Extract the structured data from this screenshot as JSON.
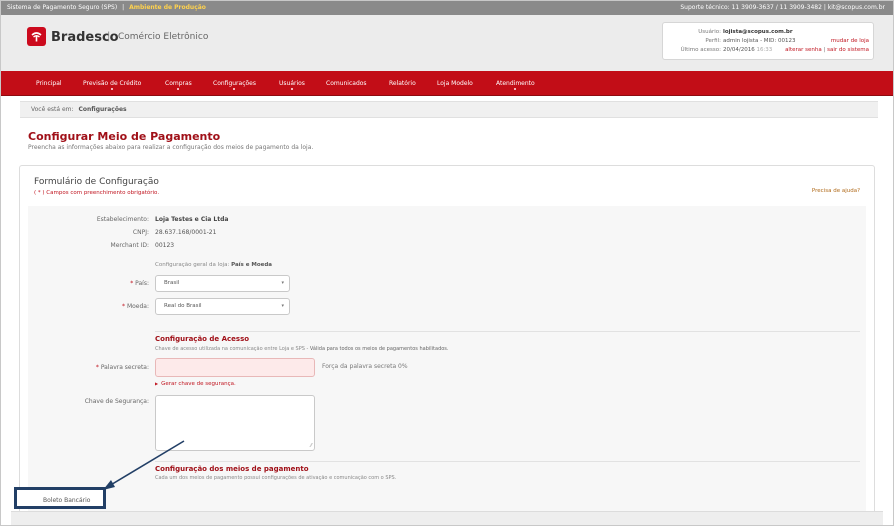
{
  "topbar": {
    "system_name": "Sistema de Pagamento Seguro (SPS)",
    "separator": "|",
    "environment": "Ambiente de Produção",
    "support": "Suporte técnico: 11 3909-3637 / 11 3909-3482 | kit@scopus.com.br"
  },
  "header": {
    "brand": "Bradesco",
    "separator": "|",
    "subtitle": "Comércio Eletrônico"
  },
  "user_box": {
    "user_label": "Usuário:",
    "user_value": "lojista@scopus.com.br",
    "profile_label": "Perfil:",
    "profile_value": "admin lojista - MID: 00123",
    "change_store_link": "mudar de loja",
    "last_access_label": "Último acesso:",
    "last_access_date": "20/04/2016",
    "last_access_time": "16:33",
    "change_password_link": "alterar senha",
    "links_separator": "|",
    "logout_link": "sair do sistema"
  },
  "nav": {
    "items": [
      "Principal",
      "Previsão de Crédito",
      "Compras",
      "Configurações",
      "Usuários",
      "Comunicados",
      "Relatório",
      "Loja Modelo",
      "Atendimento"
    ]
  },
  "breadcrumb": {
    "prefix": "Você está em:",
    "current": "Configurações"
  },
  "page": {
    "title": "Configurar Meio de Pagamento",
    "subtitle": "Preencha as informações abaixo para realizar a configuração dos meios de pagamento da loja."
  },
  "form": {
    "title": "Formulário de Configuração",
    "required_note": "( * ) Campos com preenchimento obrigatório.",
    "help_link": "Precisa de ajuda?",
    "establishment_label": "Estabelecimento:",
    "establishment_value": "Loja Testes e Cia Ltda",
    "cnpj_label": "CNPJ:",
    "cnpj_value": "28.637.168/0001-21",
    "merchant_label": "Merchant ID:",
    "merchant_value": "00123",
    "general_config_prefix": "Configuração geral da loja:",
    "general_config_bold": "País e Moeda",
    "required_mark": "*",
    "country_label": "País:",
    "country_value": "Brasil",
    "currency_label": "Moeda:",
    "currency_value": "Real do Brasil",
    "caret": "▾",
    "access_title": "Configuração de Acesso",
    "access_desc_prefix": "Chave de acesso utilizada na comunicação entre Loja e SPS -",
    "access_desc_bold": "Válida para todos os meios de pagamentos habilitados.",
    "secret_label": "Palavra secreta:",
    "secret_strength": "Força da palavra secreta 0%",
    "generate_link": "Gerar chave de segurança.",
    "generate_arrow": "▶",
    "security_key_label": "Chave de Segurança:",
    "textarea_grip": "⁄⁄",
    "payments_title": "Configuração dos meios de pagamento",
    "payments_desc": "Cada um dos meios de pagamento possui configurações de ativação e comunicação com o SPS.",
    "boleto_label": "Boleto Bancário"
  },
  "colors": {
    "brand_red": "#c20d17",
    "title_red": "#a01018",
    "annotation_blue": "#223f66"
  },
  "icons": {
    "logo": "bradesco-tree-logo-icon",
    "select_caret": "chevron-down-icon",
    "link_arrow": "triangle-right-icon",
    "textarea_resize": "resize-grip-icon"
  }
}
